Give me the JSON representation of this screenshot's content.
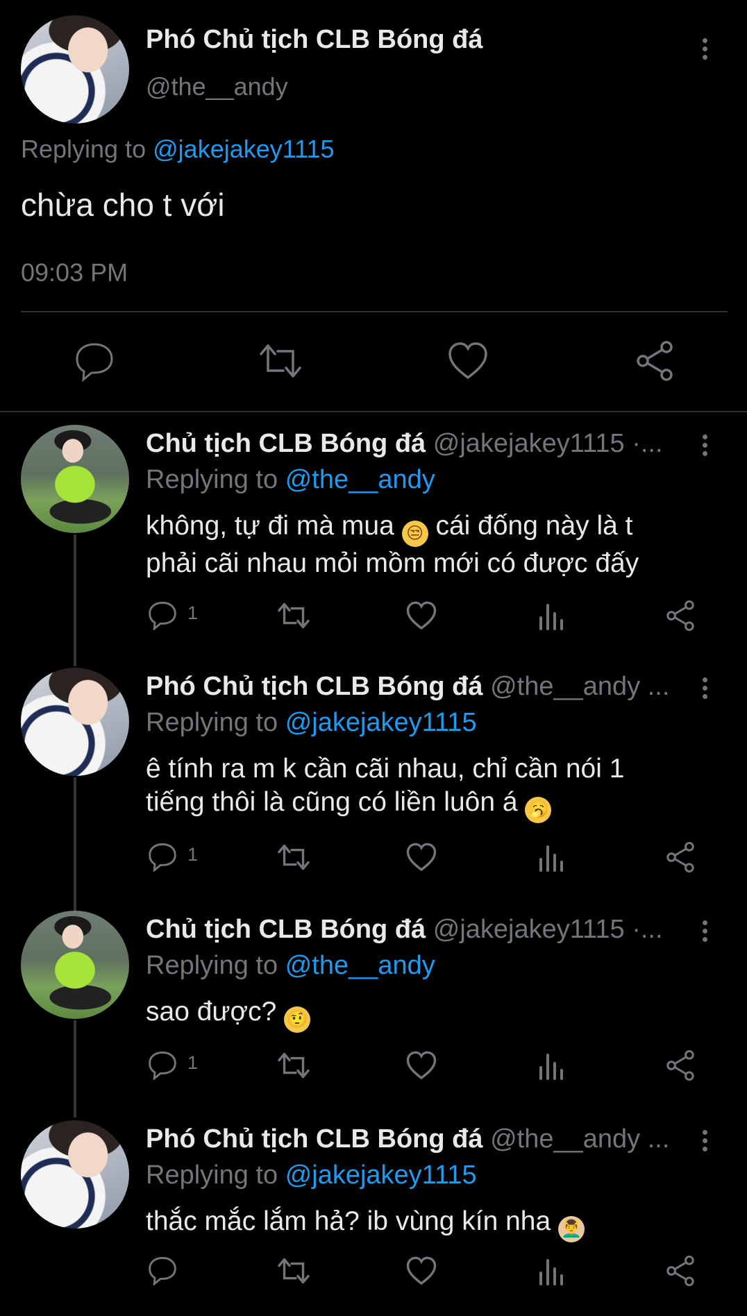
{
  "main": {
    "name": "Phó Chủ tịch CLB Bóng đá",
    "handle": "@the__andy",
    "replying_label": "Replying to",
    "replying_to": "@jakejakey1115",
    "text": "chừa cho t với",
    "time": "09:03 PM"
  },
  "replies": [
    {
      "name": "Chủ tịch CLB Bóng đá",
      "handle": "@jakejakey1115 ·...",
      "replying_label": "Replying to",
      "replying_to": "@the__andy",
      "line1": "không, tự đi mà mua",
      "emoji": "😒",
      "line1b": "cái đống này là t",
      "line2": "phải cãi nhau mỏi mồm mới có được đấy",
      "reply_count": "1"
    },
    {
      "name": "Phó Chủ tịch CLB Bóng đá",
      "handle": "@the__andy ...",
      "replying_label": "Replying to",
      "replying_to": "@jakejakey1115",
      "line1": "ê tính ra m k cần cãi nhau, chỉ cần nói 1",
      "line2": "tiếng thôi là cũng có liền luôn á",
      "emoji": "🥱",
      "reply_count": "1"
    },
    {
      "name": "Chủ tịch CLB Bóng đá",
      "handle": "@jakejakey1115 ·...",
      "replying_label": "Replying to",
      "replying_to": "@the__andy",
      "line1": "sao được?",
      "emoji": "🤨",
      "reply_count": "1"
    },
    {
      "name": "Phó Chủ tịch CLB Bóng đá",
      "handle": "@the__andy ...",
      "replying_label": "Replying to",
      "replying_to": "@jakejakey1115",
      "line1": "thắc mắc lắm hả? ib vùng kín nha",
      "emoji": "💆‍♂️",
      "reply_count": ""
    }
  ],
  "colors": {
    "background": "#000000",
    "link": "#1d9bf0",
    "muted": "#71767b",
    "text": "#e7e9ea"
  },
  "icons": [
    "more-vertical-icon",
    "reply-icon",
    "retweet-icon",
    "like-icon",
    "analytics-icon",
    "share-icon"
  ]
}
